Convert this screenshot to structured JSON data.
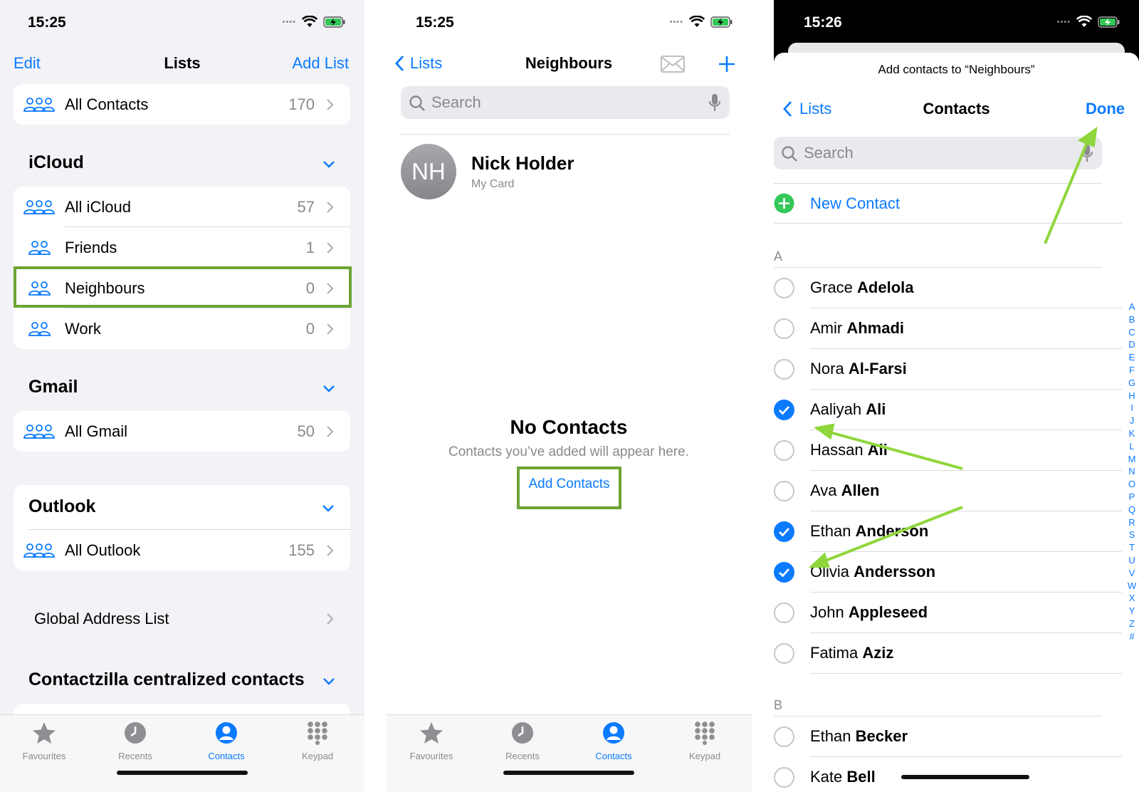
{
  "status": {
    "time1": "15:25",
    "time2": "15:25",
    "time3": "15:26"
  },
  "screen1": {
    "nav": {
      "left": "Edit",
      "title": "Lists",
      "right": "Add List"
    },
    "all_contacts": {
      "label": "All Contacts",
      "count": "170"
    },
    "sections": [
      {
        "title": "iCloud",
        "rows": [
          {
            "label": "All iCloud",
            "count": "57"
          },
          {
            "label": "Friends",
            "count": "1"
          },
          {
            "label": "Neighbours",
            "count": "0"
          },
          {
            "label": "Work",
            "count": "0"
          }
        ]
      },
      {
        "title": "Gmail",
        "rows": [
          {
            "label": "All Gmail",
            "count": "50"
          }
        ]
      },
      {
        "title": "Outlook",
        "rows": [
          {
            "label": "All Outlook",
            "count": "155"
          }
        ]
      }
    ],
    "global": "Global Address List",
    "contactzilla": "Contactzilla centralized contacts"
  },
  "screen2": {
    "nav": {
      "back": "Lists",
      "title": "Neighbours",
      "mail_icon": "envelope-icon",
      "add_icon": "plus-icon"
    },
    "search_placeholder": "Search",
    "my_card": {
      "initials": "NH",
      "name": "Nick Holder",
      "subtitle": "My Card"
    },
    "empty": {
      "title": "No Contacts",
      "message": "Contacts you’ve added will appear here.",
      "action": "Add Contacts"
    }
  },
  "tabs": [
    {
      "label": "Favourites",
      "icon": "star-icon"
    },
    {
      "label": "Recents",
      "icon": "clock-icon"
    },
    {
      "label": "Contacts",
      "icon": "person-circle-icon",
      "active": true
    },
    {
      "label": "Keypad",
      "icon": "keypad-icon"
    }
  ],
  "screen3": {
    "header": "Add contacts to “Neighbours”",
    "nav": {
      "back": "Lists",
      "title": "Contacts",
      "done": "Done"
    },
    "search_placeholder": "Search",
    "new_contact": "New Contact",
    "section_a": "A",
    "section_b": "B",
    "contacts": [
      {
        "first": "Grace",
        "last": "Adelola",
        "checked": false
      },
      {
        "first": "Amir",
        "last": "Ahmadi",
        "checked": false
      },
      {
        "first": "Nora",
        "last": "Al-Farsi",
        "checked": false
      },
      {
        "first": "Aaliyah",
        "last": "Ali",
        "checked": true
      },
      {
        "first": "Hassan",
        "last": "Ali",
        "checked": false
      },
      {
        "first": "Ava",
        "last": "Allen",
        "checked": false
      },
      {
        "first": "Ethan",
        "last": "Anderson",
        "checked": true
      },
      {
        "first": "Olivia",
        "last": "Andersson",
        "checked": true
      },
      {
        "first": "John",
        "last": "Appleseed",
        "checked": false
      },
      {
        "first": "Fatima",
        "last": "Aziz",
        "checked": false
      }
    ],
    "contacts_b": [
      {
        "first": "Ethan",
        "last": "Becker",
        "checked": false
      },
      {
        "first": "Kate",
        "last": "Bell",
        "checked": false
      }
    ],
    "index_letters": [
      "A",
      "B",
      "C",
      "D",
      "E",
      "F",
      "G",
      "H",
      "I",
      "J",
      "K",
      "L",
      "M",
      "N",
      "O",
      "P",
      "Q",
      "R",
      "S",
      "T",
      "U",
      "V",
      "W",
      "X",
      "Y",
      "Z",
      "#"
    ]
  },
  "colors": {
    "accent": "#0a7aff",
    "highlight": "#6aa535",
    "arrow": "#8fd63c",
    "add_green": "#34c759"
  }
}
